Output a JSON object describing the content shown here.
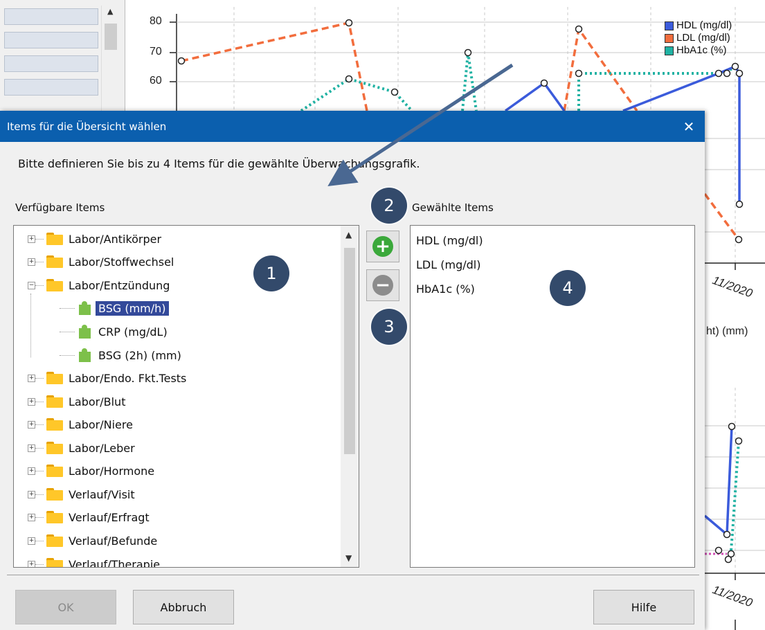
{
  "chart": {
    "y_ticks": [
      "80",
      "70",
      "60"
    ],
    "x_labels": [
      "11/2020",
      "11/2020"
    ],
    "subtitle_fragment": "ht) (mm)",
    "legend": [
      {
        "label": "HDL (mg/dl)",
        "color": "#3b5bdb"
      },
      {
        "label": "LDL (mg/dl)",
        "color": "#f26d3d"
      },
      {
        "label": "HbA1c (%)",
        "color": "#20b2a3"
      }
    ]
  },
  "dialog": {
    "title": "Items für die Übersicht wählen",
    "instruction": "Bitte definieren Sie bis zu 4 Items für die gewählte Überwachungsgrafik.",
    "available_label": "Verfügbare Items",
    "selected_label": "Gewählte Items",
    "tree": [
      {
        "label": "Labor/Antikörper",
        "type": "folder",
        "expanded": false
      },
      {
        "label": "Labor/Stoffwechsel",
        "type": "folder",
        "expanded": false
      },
      {
        "label": "Labor/Entzündung",
        "type": "folder",
        "expanded": true
      },
      {
        "label": "BSG (mm/h)",
        "type": "item",
        "selected": true
      },
      {
        "label": "CRP (mg/dL)",
        "type": "item"
      },
      {
        "label": "BSG (2h) (mm)",
        "type": "item"
      },
      {
        "label": "Labor/Endo. Fkt.Tests",
        "type": "folder",
        "expanded": false
      },
      {
        "label": "Labor/Blut",
        "type": "folder",
        "expanded": false
      },
      {
        "label": "Labor/Niere",
        "type": "folder",
        "expanded": false
      },
      {
        "label": "Labor/Leber",
        "type": "folder",
        "expanded": false
      },
      {
        "label": "Labor/Hormone",
        "type": "folder",
        "expanded": false
      },
      {
        "label": "Verlauf/Visit",
        "type": "folder",
        "expanded": false
      },
      {
        "label": "Verlauf/Erfragt",
        "type": "folder",
        "expanded": false
      },
      {
        "label": "Verlauf/Befunde",
        "type": "folder",
        "expanded": false
      },
      {
        "label": "Verlauf/Therapie",
        "type": "folder",
        "expanded": false
      }
    ],
    "chosen_items": [
      "HDL (mg/dl)",
      "LDL (mg/dl)",
      "HbA1c (%)"
    ],
    "buttons": {
      "ok": "OK",
      "cancel": "Abbruch",
      "help": "Hilfe"
    },
    "add_color": "#3aa83a",
    "remove_color": "#8c8c8c"
  },
  "annotations": [
    "1",
    "2",
    "3",
    "4"
  ]
}
